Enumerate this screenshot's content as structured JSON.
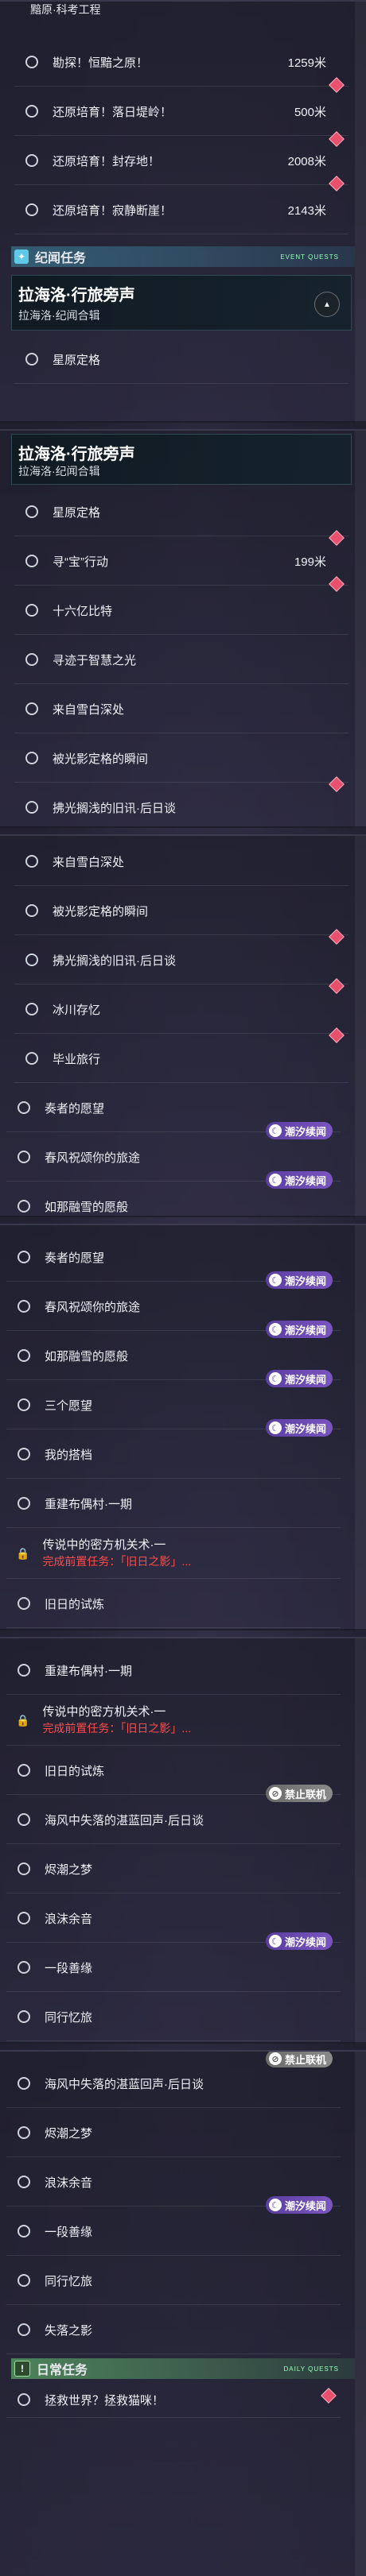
{
  "panel1": {
    "top_title": "黯原·科考工程",
    "rows": [
      {
        "label": "勘探！恒黯之原！",
        "dist": "1259米",
        "diamond": true
      },
      {
        "label": "还原培育！落日堤岭！",
        "dist": "500米",
        "diamond": true
      },
      {
        "label": "还原培育！封存地！",
        "dist": "2008米",
        "diamond": true
      },
      {
        "label": "还原培育！寂静断崖！",
        "dist": "2143米",
        "diamond": true
      }
    ],
    "section": {
      "label": "纪闻任务",
      "en": "EVENT QUESTS"
    },
    "story": {
      "title": "拉海洛·行旅旁声",
      "sub": "拉海洛·纪闻合辑"
    },
    "rows2": [
      {
        "label": "星原定格"
      }
    ]
  },
  "panel2": {
    "story": {
      "title": "拉海洛·行旅旁声",
      "sub": "拉海洛·纪闻合辑"
    },
    "rows": [
      {
        "label": "星原定格"
      },
      {
        "label": "寻“宝”行动",
        "dist": "199米",
        "diamond": true
      },
      {
        "label": "十六亿比特",
        "diamond": true
      },
      {
        "label": "寻迹于智慧之光"
      },
      {
        "label": "来自雪白深处"
      },
      {
        "label": "被光影定格的瞬间"
      },
      {
        "label": "拂光搁浅的旧讯·后日谈",
        "diamond": true
      }
    ]
  },
  "panel3": {
    "rows": [
      {
        "label": "来自雪白深处"
      },
      {
        "label": "被光影定格的瞬间"
      },
      {
        "label": "拂光搁浅的旧讯·后日谈",
        "diamond": true
      },
      {
        "label": "冰川存忆",
        "diamond": true
      },
      {
        "label": "毕业旅行",
        "diamond": true
      },
      {
        "label": "奏者的愿望",
        "badge": "潮汐续闻"
      },
      {
        "label": "春风祝颂你的旅途",
        "badge": "潮汐续闻"
      },
      {
        "label": "如那融雪的愿般",
        "badge": "潮汐续闻"
      }
    ]
  },
  "panel4": {
    "rows": [
      {
        "label": "奏者的愿望"
      },
      {
        "label": "春风祝颂你的旅途",
        "badge": "潮汐续闻"
      },
      {
        "label": "如那融雪的愿般",
        "badge": "潮汐续闻"
      },
      {
        "label": "三个愿望",
        "badge": "潮汐续闻"
      },
      {
        "label": "我的搭档",
        "badge": "潮汐续闻"
      },
      {
        "label": "重建布偶村·一期"
      },
      {
        "label": "传说中的密方机关术·一",
        "sub": "完成前置任务：「旧日之影」..."
      },
      {
        "label": "旧日的试炼"
      }
    ]
  },
  "panel5": {
    "rows": [
      {
        "label": "重建布偶村·一期"
      },
      {
        "label": "传说中的密方机关术·一",
        "sub": "完成前置任务：「旧日之影」..."
      },
      {
        "label": "旧日的试炼"
      },
      {
        "label": "海风中失落的湛蓝回声·后日谈",
        "badge": "禁止联机",
        "gray": true
      },
      {
        "label": "烬潮之梦"
      },
      {
        "label": "浪沫余音"
      },
      {
        "label": "一段善缘",
        "badge": "潮汐续闻"
      },
      {
        "label": "同行忆旅"
      }
    ]
  },
  "panel6": {
    "rows": [
      {
        "label": "海风中失落的湛蓝回声·后日谈",
        "badge": "禁止联机",
        "gray": true
      },
      {
        "label": "烬潮之梦"
      },
      {
        "label": "浪沫余音"
      },
      {
        "label": "一段善缘",
        "badge": "潮汐续闻"
      },
      {
        "label": "同行忆旅"
      },
      {
        "label": "失落之影"
      }
    ],
    "section": {
      "label": "日常任务",
      "en": "DAILY QUESTS"
    },
    "last_row": {
      "label": "拯救世界？拯救猫咪！",
      "diamond": true
    }
  },
  "colors": {
    "accent": "#7ad7ee",
    "badge": "#6a4bb0",
    "diamond": "#e8506e",
    "lock_red": "#ff4b4b"
  }
}
